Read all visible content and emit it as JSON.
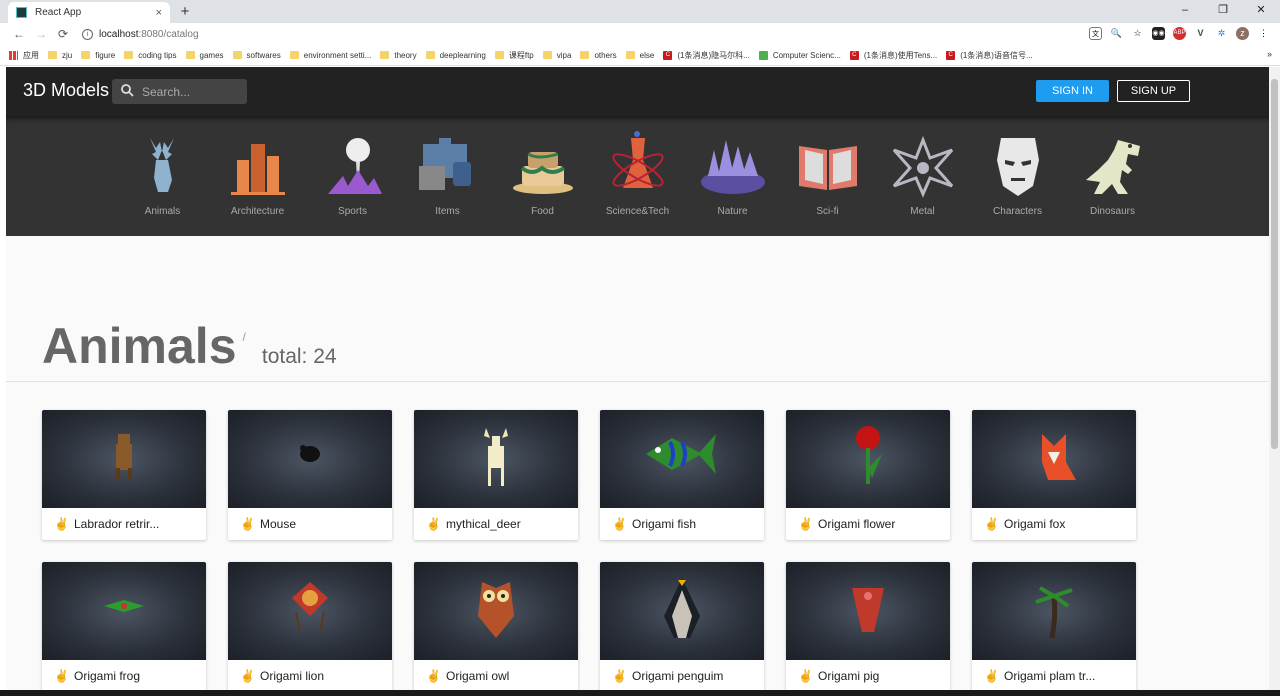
{
  "browser": {
    "tab_title": "React App",
    "tab_close": "×",
    "new_tab": "+",
    "window_controls": [
      "–",
      "❐",
      "✕"
    ],
    "url_host": "localhost",
    "url_path": ":8080/catalog",
    "bookmarks": [
      {
        "label": "应用",
        "kind": "apps"
      },
      {
        "label": "zju",
        "kind": "folder"
      },
      {
        "label": "figure",
        "kind": "folder"
      },
      {
        "label": "coding tips",
        "kind": "folder"
      },
      {
        "label": "games",
        "kind": "folder"
      },
      {
        "label": "softwares",
        "kind": "folder"
      },
      {
        "label": "environment setti...",
        "kind": "folder"
      },
      {
        "label": "theory",
        "kind": "folder"
      },
      {
        "label": "deeplearning",
        "kind": "folder"
      },
      {
        "label": "课程ftp",
        "kind": "folder"
      },
      {
        "label": "vipa",
        "kind": "folder"
      },
      {
        "label": "others",
        "kind": "folder"
      },
      {
        "label": "else",
        "kind": "folder"
      },
      {
        "label": "(1条消息)隐马尔科...",
        "kind": "csdn"
      },
      {
        "label": "Computer Scienc...",
        "kind": "green"
      },
      {
        "label": "(1条消息)使用Tens...",
        "kind": "csdn"
      },
      {
        "label": "(1条消息)语音信号...",
        "kind": "csdn"
      }
    ],
    "bookmarks_more": "»"
  },
  "header": {
    "brand": "3D Models",
    "search_placeholder": "Search...",
    "sign_in": "SIGN IN",
    "sign_up": "SIGN UP"
  },
  "categories": [
    {
      "label": "Animals",
      "icon": "deer-icon",
      "color": "#8fb3cf"
    },
    {
      "label": "Architecture",
      "icon": "buildings-icon",
      "color": "#e8874a"
    },
    {
      "label": "Sports",
      "icon": "golf-ball-icon",
      "color": "#9b59d0"
    },
    {
      "label": "Items",
      "icon": "briefcase-icon",
      "color": "#5c7fa8"
    },
    {
      "label": "Food",
      "icon": "cake-icon",
      "color": "#e9c995"
    },
    {
      "label": "Science&Tech",
      "icon": "flask-atom-icon",
      "color": "#e0623d"
    },
    {
      "label": "Nature",
      "icon": "forest-icon",
      "color": "#9b8fe0"
    },
    {
      "label": "Sci-fi",
      "icon": "book-icon",
      "color": "#e07a6a"
    },
    {
      "label": "Metal",
      "icon": "metal-emblem-icon",
      "color": "#b8b8c4"
    },
    {
      "label": "Characters",
      "icon": "iron-mask-icon",
      "color": "#e8e8e8"
    },
    {
      "label": "Dinosaurs",
      "icon": "dinosaur-icon",
      "color": "#e4e6c8"
    }
  ],
  "main": {
    "title": "Animals",
    "separator": "/",
    "total": "total: 24"
  },
  "models": [
    {
      "name": "Labrador retrir...",
      "figure": "dog",
      "color": "#8a5a2b"
    },
    {
      "name": "Mouse",
      "figure": "mouse",
      "color": "#111111"
    },
    {
      "name": "mythical_deer",
      "figure": "deer",
      "color": "#f2ecc8"
    },
    {
      "name": "Origami fish",
      "figure": "fish",
      "color": "#2e8b2e"
    },
    {
      "name": "Origami flower",
      "figure": "flower",
      "color": "#c41414"
    },
    {
      "name": "Origami fox",
      "figure": "fox",
      "color": "#e8502a"
    },
    {
      "name": "Origami frog",
      "figure": "frog",
      "color": "#2e9b2e"
    },
    {
      "name": "Origami lion",
      "figure": "lion",
      "color": "#c0392b"
    },
    {
      "name": "Origami owl",
      "figure": "owl",
      "color": "#b5522a"
    },
    {
      "name": "Origami penguim",
      "figure": "penguin",
      "color": "#c9c2b8"
    },
    {
      "name": "Origami pig",
      "figure": "pig",
      "color": "#c0392b"
    },
    {
      "name": "Origami plam tr...",
      "figure": "palm",
      "color": "#3c2a1e"
    }
  ]
}
